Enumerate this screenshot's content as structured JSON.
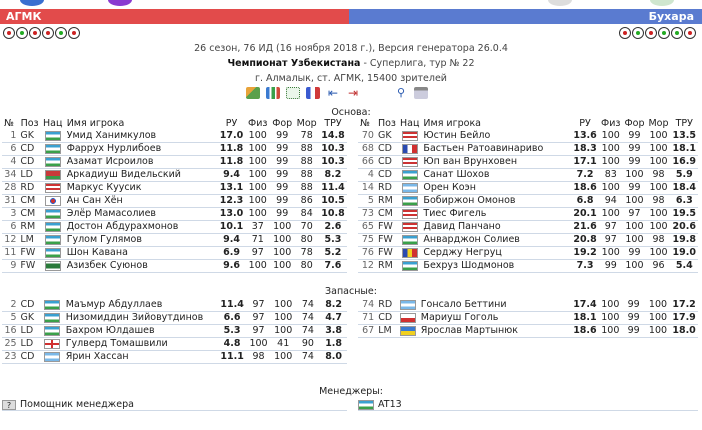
{
  "header": {
    "team_left": "АГМК",
    "team_right": "Бухара",
    "colors": {
      "left_bar": "#e24b4b",
      "right_bar": "#5a7bd0"
    },
    "balls_left": [
      "red",
      "green",
      "red",
      "red",
      "green",
      "red"
    ],
    "balls_right": [
      "red",
      "green",
      "red",
      "green",
      "green",
      "red"
    ]
  },
  "info": {
    "line1": "26 сезон, 76 ИД (16 ноября 2018 г.), Версия генератора 26.0.4",
    "tournament": "Чемпионат Узбекистана",
    "round": " - Суперлига, тур № 22",
    "stadium": "г. Алмалык, ст. АГМК, 15400 зрителей"
  },
  "toolbar_icons": [
    "team-icon",
    "bar-chart-icon",
    "formation-icon",
    "flags-icon",
    "arrow-left-icon",
    "arrow-right-icon",
    "search-icon",
    "print-icon"
  ],
  "labels": {
    "main": "Основа:",
    "subs": "Запасные:",
    "managers": "Менеджеры:"
  },
  "columns_left": [
    "№",
    "Поз",
    "Нац",
    "Имя игрока",
    "РУ",
    "Физ",
    "Фор",
    "Мор",
    "ТРУ"
  ],
  "columns_right": [
    "№",
    "Поз",
    "Нац",
    "Имя игрока",
    "РУ",
    "Физ",
    "Фор",
    "Мор",
    "ТРУ"
  ],
  "home_main": [
    {
      "no": "1",
      "pos": "GK",
      "flag": "uz",
      "name": "Умид Ханимкулов",
      "ru": "17.0",
      "fiz": "100",
      "for": "99",
      "mor": "78",
      "tru": "14.8"
    },
    {
      "no": "6",
      "pos": "CD",
      "flag": "uz",
      "name": "Фаррух Нурлибоев",
      "ru": "11.8",
      "fiz": "100",
      "for": "99",
      "mor": "88",
      "tru": "10.3"
    },
    {
      "no": "4",
      "pos": "CD",
      "flag": "uz",
      "name": "Азамат Исроилов",
      "ru": "11.8",
      "fiz": "100",
      "for": "99",
      "mor": "88",
      "tru": "10.3"
    },
    {
      "no": "34",
      "pos": "LD",
      "flag": "by",
      "name": "Аркадиуш Видельский",
      "ru": "9.4",
      "fiz": "100",
      "for": "99",
      "mor": "88",
      "tru": "8.2"
    },
    {
      "no": "28",
      "pos": "RD",
      "flag": "us",
      "name": "Маркус Куусик",
      "ru": "13.1",
      "fiz": "100",
      "for": "99",
      "mor": "88",
      "tru": "11.4"
    },
    {
      "no": "31",
      "pos": "CM",
      "flag": "kr",
      "name": "Ан Сан Хён",
      "ru": "12.3",
      "fiz": "100",
      "for": "99",
      "mor": "86",
      "tru": "10.5"
    },
    {
      "no": "3",
      "pos": "CM",
      "flag": "uz",
      "name": "Элёр Мамасолиев",
      "ru": "13.0",
      "fiz": "100",
      "for": "99",
      "mor": "84",
      "tru": "10.8"
    },
    {
      "no": "6",
      "pos": "RM",
      "flag": "uz",
      "name": "Достон Абдурахмонов",
      "ru": "10.1",
      "fiz": "37",
      "for": "100",
      "mor": "70",
      "tru": "2.6"
    },
    {
      "no": "12",
      "pos": "LM",
      "flag": "uz",
      "name": "Гулом Гулямов",
      "ru": "9.4",
      "fiz": "71",
      "for": "100",
      "mor": "80",
      "tru": "5.3"
    },
    {
      "no": "11",
      "pos": "FW",
      "flag": "uz",
      "name": "Шон Кавана",
      "ru": "6.9",
      "fiz": "97",
      "for": "100",
      "mor": "78",
      "tru": "5.2"
    },
    {
      "no": "9",
      "pos": "FW",
      "flag": "cy",
      "name": "Азизбек Суюнов",
      "ru": "9.6",
      "fiz": "100",
      "for": "100",
      "mor": "80",
      "tru": "7.6"
    }
  ],
  "away_main": [
    {
      "no": "70",
      "pos": "GK",
      "flag": "us",
      "name": "Юстин Бейло",
      "ru": "13.6",
      "fiz": "100",
      "for": "99",
      "mor": "100",
      "tru": "13.5"
    },
    {
      "no": "68",
      "pos": "CD",
      "flag": "fr",
      "name": "Бастьен Ратоавинариво",
      "ru": "18.3",
      "fiz": "100",
      "for": "99",
      "mor": "100",
      "tru": "18.1"
    },
    {
      "no": "66",
      "pos": "CD",
      "flag": "us",
      "name": "Юп ван Врунховен",
      "ru": "17.1",
      "fiz": "100",
      "for": "99",
      "mor": "100",
      "tru": "16.9"
    },
    {
      "no": "4",
      "pos": "CD",
      "flag": "uz",
      "name": "Санат Шохов",
      "ru": "7.2",
      "fiz": "83",
      "for": "100",
      "mor": "98",
      "tru": "5.9"
    },
    {
      "no": "14",
      "pos": "RD",
      "flag": "ar",
      "name": "Орен Коэн",
      "ru": "18.6",
      "fiz": "100",
      "for": "99",
      "mor": "100",
      "tru": "18.4"
    },
    {
      "no": "5",
      "pos": "RM",
      "flag": "uz",
      "name": "Бобиржон Омонов",
      "ru": "6.8",
      "fiz": "94",
      "for": "100",
      "mor": "98",
      "tru": "6.3"
    },
    {
      "no": "73",
      "pos": "CM",
      "flag": "us",
      "name": "Тиес Фигель",
      "ru": "20.1",
      "fiz": "100",
      "for": "97",
      "mor": "100",
      "tru": "19.5"
    },
    {
      "no": "65",
      "pos": "FW",
      "flag": "us",
      "name": "Давид Панчано",
      "ru": "21.6",
      "fiz": "97",
      "for": "100",
      "mor": "100",
      "tru": "20.6"
    },
    {
      "no": "75",
      "pos": "FW",
      "flag": "uz",
      "name": "Анварджон Солиев",
      "ru": "20.8",
      "fiz": "97",
      "for": "100",
      "mor": "98",
      "tru": "19.8"
    },
    {
      "no": "76",
      "pos": "FW",
      "flag": "ro",
      "name": "Серджу Негруц",
      "ru": "19.2",
      "fiz": "100",
      "for": "99",
      "mor": "100",
      "tru": "19.0"
    },
    {
      "no": "12",
      "pos": "RM",
      "flag": "uz",
      "name": "Бехруз Шодмонов",
      "ru": "7.3",
      "fiz": "99",
      "for": "100",
      "mor": "96",
      "tru": "5.4"
    }
  ],
  "home_subs": [
    {
      "no": "2",
      "pos": "CD",
      "flag": "uz",
      "name": "Маъмур Абдуллаев",
      "ru": "11.4",
      "fiz": "97",
      "for": "100",
      "mor": "74",
      "tru": "8.2"
    },
    {
      "no": "5",
      "pos": "GK",
      "flag": "uz",
      "name": "Низомиддин Зийовутдинов",
      "ru": "6.6",
      "fiz": "97",
      "for": "100",
      "mor": "74",
      "tru": "4.7"
    },
    {
      "no": "16",
      "pos": "LD",
      "flag": "uz",
      "name": "Бахром Юлдашев",
      "ru": "5.3",
      "fiz": "97",
      "for": "100",
      "mor": "74",
      "tru": "3.8"
    },
    {
      "no": "25",
      "pos": "LD",
      "flag": "en",
      "name": "Гулверд Томашвили",
      "ru": "4.8",
      "fiz": "100",
      "for": "41",
      "mor": "90",
      "tru": "1.8"
    },
    {
      "no": "23",
      "pos": "CD",
      "flag": "ar",
      "name": "Ярин Хассан",
      "ru": "11.1",
      "fiz": "98",
      "for": "100",
      "mor": "74",
      "tru": "8.0"
    }
  ],
  "away_subs": [
    {
      "no": "74",
      "pos": "RD",
      "flag": "ar",
      "name": "Гонсало Беттини",
      "ru": "17.4",
      "fiz": "100",
      "for": "99",
      "mor": "100",
      "tru": "17.2"
    },
    {
      "no": "71",
      "pos": "CD",
      "flag": "pl",
      "name": "Мариуш Гоголь",
      "ru": "18.1",
      "fiz": "100",
      "for": "99",
      "mor": "100",
      "tru": "17.9"
    },
    {
      "no": "67",
      "pos": "LM",
      "flag": "ua",
      "name": "Ярослав Мартынюк",
      "ru": "18.6",
      "fiz": "100",
      "for": "99",
      "mor": "100",
      "tru": "18.0"
    }
  ],
  "managers": {
    "home": "Помощник менеджера",
    "away": "AT13",
    "home_icon": "unknown-flag-icon",
    "away_flag": "uz"
  }
}
